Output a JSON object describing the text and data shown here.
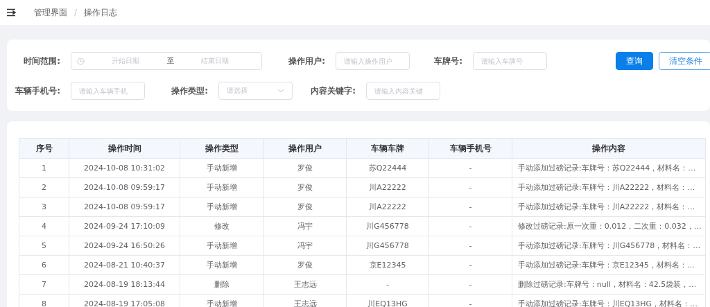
{
  "breadcrumb": [
    "管理界面",
    "/",
    "操作日志"
  ],
  "filters": {
    "row1": [
      {
        "kind": "daterange",
        "label": "时间范围:",
        "start_placeholder": "开始日期",
        "separator": "至",
        "end_placeholder": "结束日期"
      },
      {
        "kind": "input",
        "label": "操作用户:",
        "placeholder": "请输入操作用户"
      },
      {
        "kind": "input",
        "label": "车牌号:",
        "placeholder": "请输入车牌号"
      }
    ],
    "row2": [
      {
        "kind": "input",
        "label": "车辆手机号:",
        "placeholder": "请输入车辆手机"
      },
      {
        "kind": "select",
        "label": "操作类型:",
        "placeholder": "请选择"
      },
      {
        "kind": "input",
        "label": "内容关键字:",
        "placeholder": "请输入内容关键"
      }
    ],
    "buttons": [
      {
        "kind": "primary",
        "label": "查询"
      },
      {
        "kind": "plain",
        "label": "清空条件"
      }
    ]
  },
  "table": {
    "columns": [
      "序号",
      "操作时间",
      "操作类型",
      "操作用户",
      "车辆车牌",
      "车辆手机号",
      "操作内容"
    ],
    "rows": [
      [
        "1",
        "2024-10-08 10:31:02",
        "手动新增",
        "罗俊",
        "苏Q22444",
        "-",
        "手动添加过磅记录:车牌号：苏Q22444，材料名：…"
      ],
      [
        "2",
        "2024-10-08 09:59:17",
        "手动新增",
        "罗俊",
        "川A22222",
        "-",
        "手动添加过磅记录:车牌号：川A22222，材料名：…"
      ],
      [
        "3",
        "2024-10-08 09:59:17",
        "手动新增",
        "罗俊",
        "川A22222",
        "-",
        "手动添加过磅记录:车牌号：川A22222，材料名：…"
      ],
      [
        "4",
        "2024-09-24 17:10:09",
        "修改",
        "冯宇",
        "川G456778",
        "-",
        "修改过磅记录:原一次重：0.012，二次重：0.032，…"
      ],
      [
        "5",
        "2024-09-24 16:50:26",
        "手动新增",
        "冯宇",
        "川G456778",
        "-",
        "手动添加过磅记录:车牌号：川G456778，材料名：…"
      ],
      [
        "6",
        "2024-08-21 10:40:37",
        "手动新增",
        "罗俊",
        "京E12345",
        "-",
        "手动添加过磅记录:车牌号：京E12345，材料名：…"
      ],
      [
        "7",
        "2024-08-19 18:13:44",
        "删除",
        "王志远",
        "-",
        "-",
        "删除过磅记录:车牌号：null，材料名：42.5袋装，…"
      ],
      [
        "8",
        "2024-08-19 17:05:08",
        "手动新增",
        "王志远",
        "川EQ13HG",
        "-",
        "手动添加过磅记录:车牌号：川EQ13HG，材料名：…"
      ]
    ]
  }
}
